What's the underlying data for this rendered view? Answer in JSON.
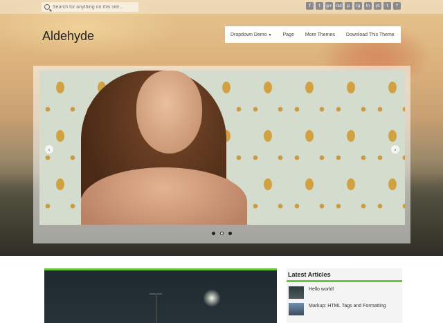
{
  "search": {
    "placeholder": "Search for anything on this site..."
  },
  "social": [
    "f",
    "t",
    "g+",
    "rss",
    "p",
    "ig",
    "in",
    "yt",
    "t",
    "f"
  ],
  "logo": "Aldehyde",
  "nav": {
    "items": [
      {
        "label": "Dropdown Demo"
      },
      {
        "label": "Page"
      },
      {
        "label": "More Themes"
      },
      {
        "label": "Download This Theme"
      }
    ]
  },
  "slider": {
    "slides": 3,
    "active": 1
  },
  "sidebar": {
    "title": "Latest Articles",
    "articles": [
      {
        "title": "Hello world!"
      },
      {
        "title": "Markup: HTML Tags and Formatting"
      }
    ]
  },
  "colors": {
    "accent": "#67c73a",
    "nav_bg": "#ffffff"
  }
}
